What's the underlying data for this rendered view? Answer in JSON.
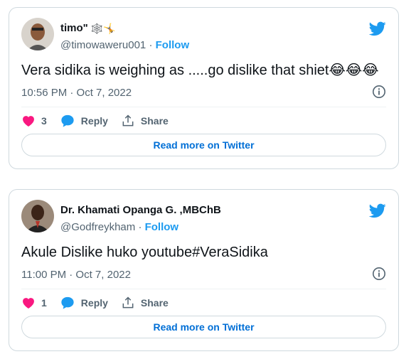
{
  "tweets": [
    {
      "name": "timo\"",
      "name_emoji": "🕸️🤸",
      "handle": "@timowaweru001",
      "separator": "·",
      "follow_label": "Follow",
      "text": "Vera sidika is weighing as .....go dislike that shiet",
      "text_emoji": "😂😂😂",
      "timestamp": "10:56 PM · Oct 7, 2022",
      "like_count": "3",
      "reply_label": "Reply",
      "share_label": "Share",
      "read_more_label": "Read more on Twitter"
    },
    {
      "name": "Dr. Khamati Opanga G. ,MBChB",
      "name_emoji": "",
      "handle": "@Godfreykham",
      "separator": "·",
      "follow_label": "Follow",
      "text": "Akule Dislike huko youtube#VeraSidika",
      "text_emoji": "",
      "timestamp": "11:00 PM · Oct 7, 2022",
      "like_count": "1",
      "reply_label": "Reply",
      "share_label": "Share",
      "read_more_label": "Read more on Twitter"
    }
  ],
  "colors": {
    "twitter_blue": "#1d9bf0",
    "heart_pink": "#f91880",
    "border": "#cfd9de",
    "secondary_text": "#536471"
  },
  "icons": [
    "twitter-bird-icon",
    "info-icon",
    "heart-icon",
    "reply-bubble-icon",
    "share-icon"
  ]
}
